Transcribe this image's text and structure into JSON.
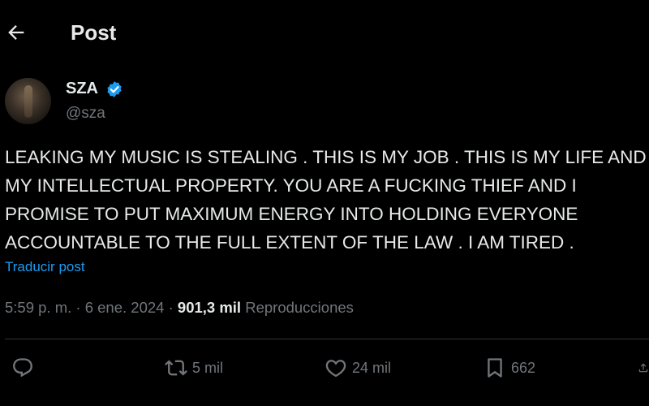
{
  "header": {
    "title": "Post"
  },
  "author": {
    "name": "SZA",
    "handle": "@sza"
  },
  "post": {
    "text": "LEAKING MY MUSIC IS STEALING . THIS IS MY JOB . THIS IS MY LIFE AND MY INTELLECTUAL PROPERTY. YOU ARE A FUCKING THIEF AND I PROMISE TO PUT MAXIMUM ENERGY INTO HOLDING EVERYONE ACCOUNTABLE TO THE FULL EXTENT OF THE LAW . I AM TIRED .",
    "translate_label": "Traducir post"
  },
  "meta": {
    "time": "5:59 p. m.",
    "separator": " · ",
    "date": "6 ene. 2024",
    "views_count": "901,3 mil",
    "views_label": "Reproducciones"
  },
  "actions": {
    "reply_icon": "reply-icon",
    "repost_count": "5 mil",
    "like_count": "24 mil",
    "bookmark_count": "662"
  },
  "colors": {
    "background": "#000000",
    "text": "#e7e9ea",
    "secondary_text": "#71767b",
    "link": "#1d9bf0",
    "verified": "#1d9bf0"
  }
}
